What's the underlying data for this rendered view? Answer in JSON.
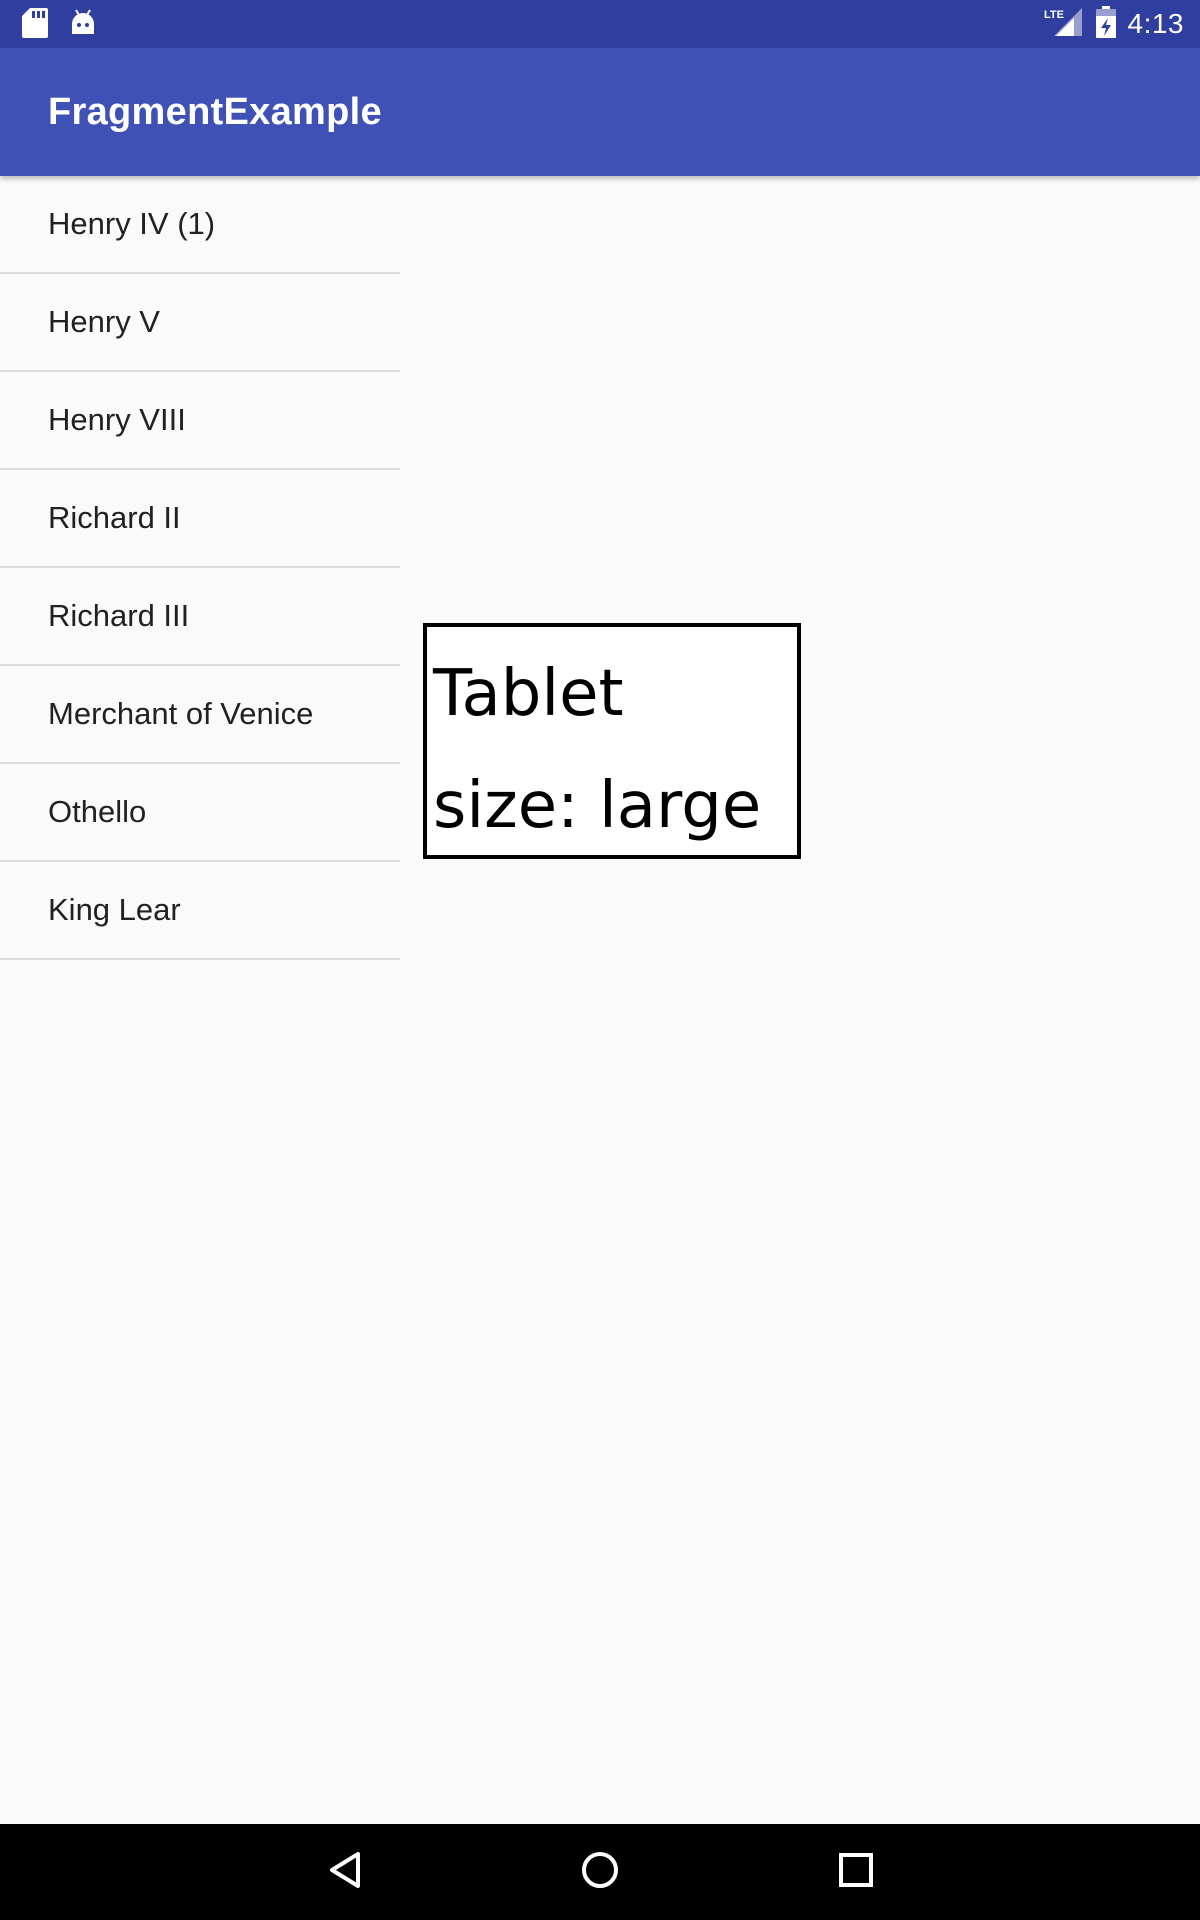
{
  "status_bar": {
    "time": "4:13",
    "network": "LTE",
    "icons": [
      "sd-card-icon",
      "android-debug-icon",
      "lte-signal-icon",
      "battery-charging-icon"
    ]
  },
  "app_bar": {
    "title": "FragmentExample"
  },
  "list": {
    "items": [
      {
        "label": "Henry IV (1)"
      },
      {
        "label": "Henry V"
      },
      {
        "label": "Henry VIII"
      },
      {
        "label": "Richard II"
      },
      {
        "label": "Richard III"
      },
      {
        "label": "Merchant of Venice"
      },
      {
        "label": "Othello"
      },
      {
        "label": "King Lear"
      }
    ]
  },
  "detail": {
    "line1": "Tablet",
    "line2": "size: large"
  },
  "nav_bar": {
    "icons": [
      "back-icon",
      "home-icon",
      "recents-icon"
    ]
  },
  "colors": {
    "status_bar": "#303f9f",
    "app_bar": "#3f51b5",
    "background": "#fafafa"
  }
}
